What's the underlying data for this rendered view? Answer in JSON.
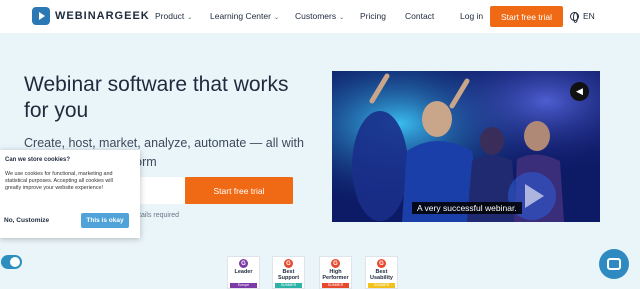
{
  "brand": {
    "name": "WEBINARGEEK"
  },
  "nav": {
    "items": [
      {
        "label": "Product",
        "has_dropdown": true
      },
      {
        "label": "Learning Center",
        "has_dropdown": true
      },
      {
        "label": "Customers",
        "has_dropdown": true
      },
      {
        "label": "Pricing",
        "has_dropdown": false
      },
      {
        "label": "Contact",
        "has_dropdown": false
      }
    ],
    "login": "Log in",
    "cta": "Start free trial",
    "language": "EN"
  },
  "hero": {
    "headline": "Webinar software that works for you",
    "subtitle": "Create, host, market, analyze, automate — all with riendly webinar platform",
    "email_value": "",
    "cta": "Start free trial",
    "hint": "tails required"
  },
  "video": {
    "caption": "A very successful webinar.",
    "mute_icon": "speaker-icon"
  },
  "cookie_dialog": {
    "title": "Can we store cookies?",
    "body": "We use cookies for functional, marketing and statistical purposes. Accepting all cookies will greatly improve your website experience!",
    "customize": "No, Customize",
    "accept": "This is okay"
  },
  "badges": [
    {
      "title": "Leader",
      "strip": "Europe",
      "year": "",
      "strip_color": "#7b3aa8"
    },
    {
      "title": "Best Support",
      "strip": "SUMMER",
      "year": "2023",
      "strip_color": "#2bb3a8"
    },
    {
      "title": "High Performer",
      "strip": "SUMMER",
      "year": "2023",
      "strip_color": "#e8492e"
    },
    {
      "title": "Best Usability",
      "strip": "SUMMER",
      "year": "2023",
      "strip_color": "#f2c21b"
    }
  ],
  "colors": {
    "accent": "#f06a16",
    "brand": "#2a79b5",
    "background": "#eaf5fa"
  }
}
